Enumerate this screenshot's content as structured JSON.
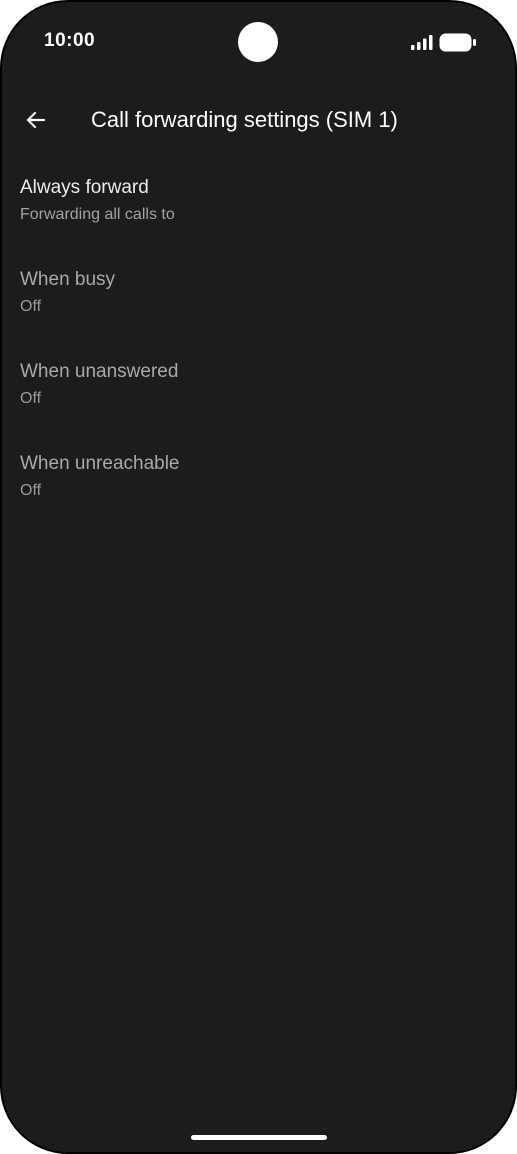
{
  "status_bar": {
    "time": "10:00",
    "signal_icon": "signal-bars-icon",
    "battery_icon": "battery-full-icon"
  },
  "app_bar": {
    "back_icon": "arrow-back-icon",
    "title": "Call forwarding settings (SIM 1)"
  },
  "settings": {
    "items": [
      {
        "title": "Always forward",
        "summary": "Forwarding all calls to",
        "enabled": true
      },
      {
        "title": "When busy",
        "summary": "Off",
        "enabled": false
      },
      {
        "title": "When unanswered",
        "summary": "Off",
        "enabled": false
      },
      {
        "title": "When unreachable",
        "summary": "Off",
        "enabled": false
      }
    ]
  },
  "colors": {
    "background": "#1c1c1c",
    "frame": "#000000",
    "text_primary": "#ececec",
    "text_secondary": "#a3a3a3"
  }
}
